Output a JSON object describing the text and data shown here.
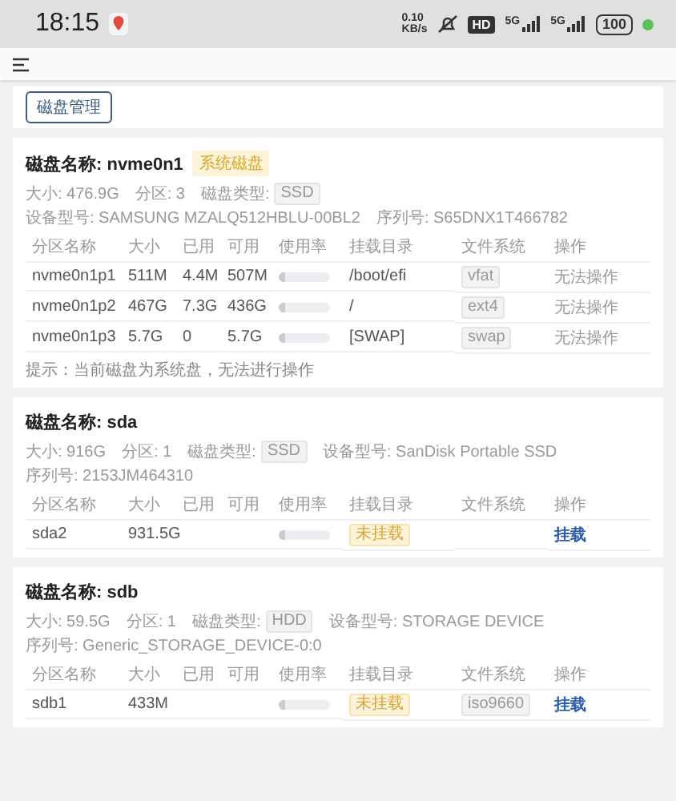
{
  "status_bar": {
    "time": "18:15",
    "net_speed": "0.10",
    "net_unit": "KB/s",
    "hd": "HD",
    "signals": [
      "5G",
      "5G"
    ],
    "battery": "100"
  },
  "tabs": [
    {
      "label": "磁盘管理",
      "selected": true
    }
  ],
  "disks": [
    {
      "title": "磁盘名称: nvme0n1",
      "badge": "系统磁盘",
      "info": [
        {
          "kind": "text",
          "text": "大小: 476.9G"
        },
        {
          "kind": "text",
          "text": "分区: 3"
        },
        {
          "kind": "tag",
          "label": "磁盘类型:",
          "tag": "SSD"
        },
        {
          "kind": "text",
          "text": "设备型号: SAMSUNG MZALQ512HBLU-00BL2"
        },
        {
          "kind": "text",
          "text": "序列号: S65DNX1T466782"
        }
      ],
      "columns": [
        "分区名称",
        "大小",
        "已用",
        "可用",
        "使用率",
        "挂载目录",
        "文件系统",
        "操作"
      ],
      "rows": [
        {
          "name": "nvme0n1p1",
          "size": "511M",
          "used": "4.4M",
          "available": "507M",
          "level": 0.01,
          "mount": "/boot/efi",
          "mounted": true,
          "fs": "vfat",
          "action": "无法操作",
          "disabled": true
        },
        {
          "name": "nvme0n1p2",
          "size": "467G",
          "used": "7.3G",
          "available": "436G",
          "level": 0.02,
          "mount": "/",
          "mounted": true,
          "fs": "ext4",
          "action": "无法操作",
          "disabled": true
        },
        {
          "name": "nvme0n1p3",
          "size": "5.7G",
          "used": "0",
          "available": "5.7G",
          "level": 0,
          "mount": "[SWAP]",
          "mounted": true,
          "fs": "swap",
          "action": "无法操作",
          "disabled": true
        }
      ],
      "note": "提示：当前磁盘为系统盘，无法进行操作"
    },
    {
      "title": "磁盘名称: sda",
      "info": [
        {
          "kind": "text",
          "text": "大小: 916G"
        },
        {
          "kind": "text",
          "text": "分区: 1"
        },
        {
          "kind": "tag",
          "label": "磁盘类型:",
          "tag": "SSD"
        },
        {
          "kind": "text",
          "text": "设备型号: SanDisk Portable SSD"
        },
        {
          "kind": "text",
          "text": "序列号: 2153JM464310"
        }
      ],
      "columns": [
        "分区名称",
        "大小",
        "已用",
        "可用",
        "使用率",
        "挂载目录",
        "文件系统",
        "操作"
      ],
      "rows": [
        {
          "name": "sda2",
          "size": "931.5G",
          "level": 0,
          "mount": "未挂载",
          "mounted": false,
          "action": "挂载",
          "disabled": false
        }
      ]
    },
    {
      "title": "磁盘名称: sdb",
      "info": [
        {
          "kind": "text",
          "text": "大小: 59.5G"
        },
        {
          "kind": "text",
          "text": "分区: 1"
        },
        {
          "kind": "tag",
          "label": "磁盘类型:",
          "tag": "HDD"
        },
        {
          "kind": "text",
          "text": "设备型号: STORAGE DEVICE"
        },
        {
          "kind": "text",
          "text": "序列号: Generic_STORAGE_DEVICE-0:0"
        }
      ],
      "columns": [
        "分区名称",
        "大小",
        "已用",
        "可用",
        "使用率",
        "挂载目录",
        "文件系统",
        "操作"
      ],
      "rows": [
        {
          "name": "sdb1",
          "size": "433M",
          "level": 0,
          "mount": "未挂载",
          "mounted": false,
          "fs": "iso9660",
          "action": "挂载",
          "disabled": false
        }
      ]
    }
  ]
}
